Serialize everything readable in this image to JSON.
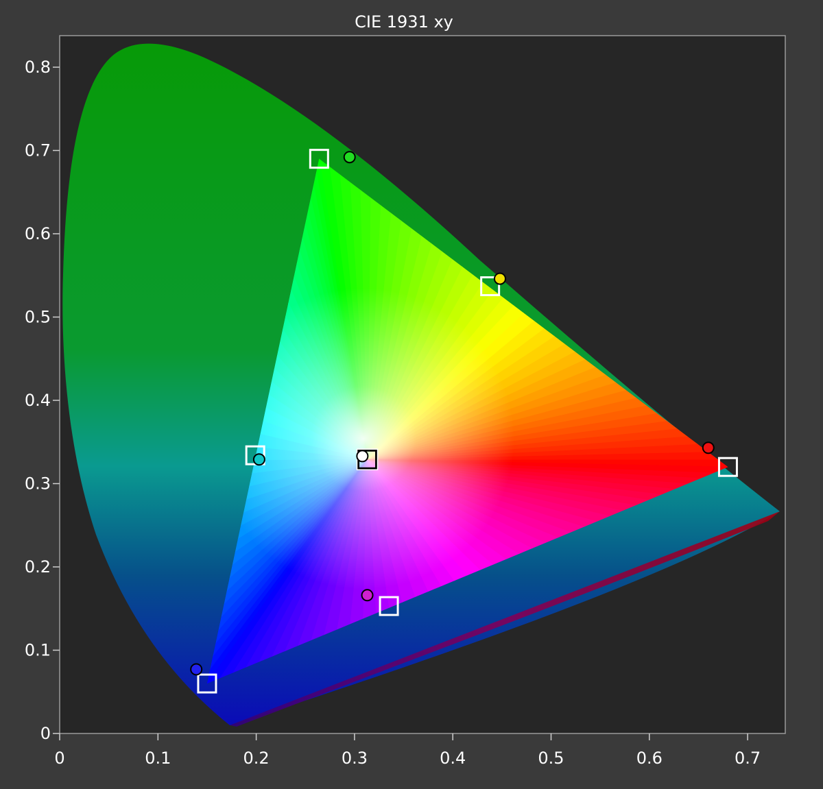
{
  "chart_data": {
    "type": "scatter",
    "title": "CIE 1931 xy",
    "xlabel": "",
    "ylabel": "",
    "xlim": [
      0,
      0.74
    ],
    "ylim": [
      0,
      0.84
    ],
    "x_ticks": [
      "0",
      "0.1",
      "0.2",
      "0.3",
      "0.4",
      "0.5",
      "0.6",
      "0.7"
    ],
    "y_ticks": [
      "0",
      "0.1",
      "0.2",
      "0.3",
      "0.4",
      "0.5",
      "0.6",
      "0.7",
      "0.8"
    ],
    "grid": false,
    "series": [
      {
        "marker": "square",
        "points": [
          {
            "x": 0.264,
            "y": 0.69
          },
          {
            "x": 0.438,
            "y": 0.537
          },
          {
            "x": 0.68,
            "y": 0.32
          },
          {
            "x": 0.335,
            "y": 0.153
          },
          {
            "x": 0.15,
            "y": 0.06
          },
          {
            "x": 0.199,
            "y": 0.334
          },
          {
            "x": 0.313,
            "y": 0.329
          }
        ]
      },
      {
        "marker": "circle",
        "points": [
          {
            "x": 0.295,
            "y": 0.692,
            "color": "#22dd22"
          },
          {
            "x": 0.448,
            "y": 0.546,
            "color": "#f0e000"
          },
          {
            "x": 0.66,
            "y": 0.343,
            "color": "#ee1111"
          },
          {
            "x": 0.313,
            "y": 0.166,
            "color": "#d020d0"
          },
          {
            "x": 0.139,
            "y": 0.077,
            "color": "#2222ee"
          },
          {
            "x": 0.203,
            "y": 0.329,
            "color": "#10c8c8"
          },
          {
            "x": 0.308,
            "y": 0.333,
            "color": "#ffffff"
          }
        ]
      }
    ],
    "colors": {
      "background": "#3a3a3a",
      "plot_background": "#262626",
      "text": "#ffffff",
      "axis": "#d0d0d0"
    }
  }
}
